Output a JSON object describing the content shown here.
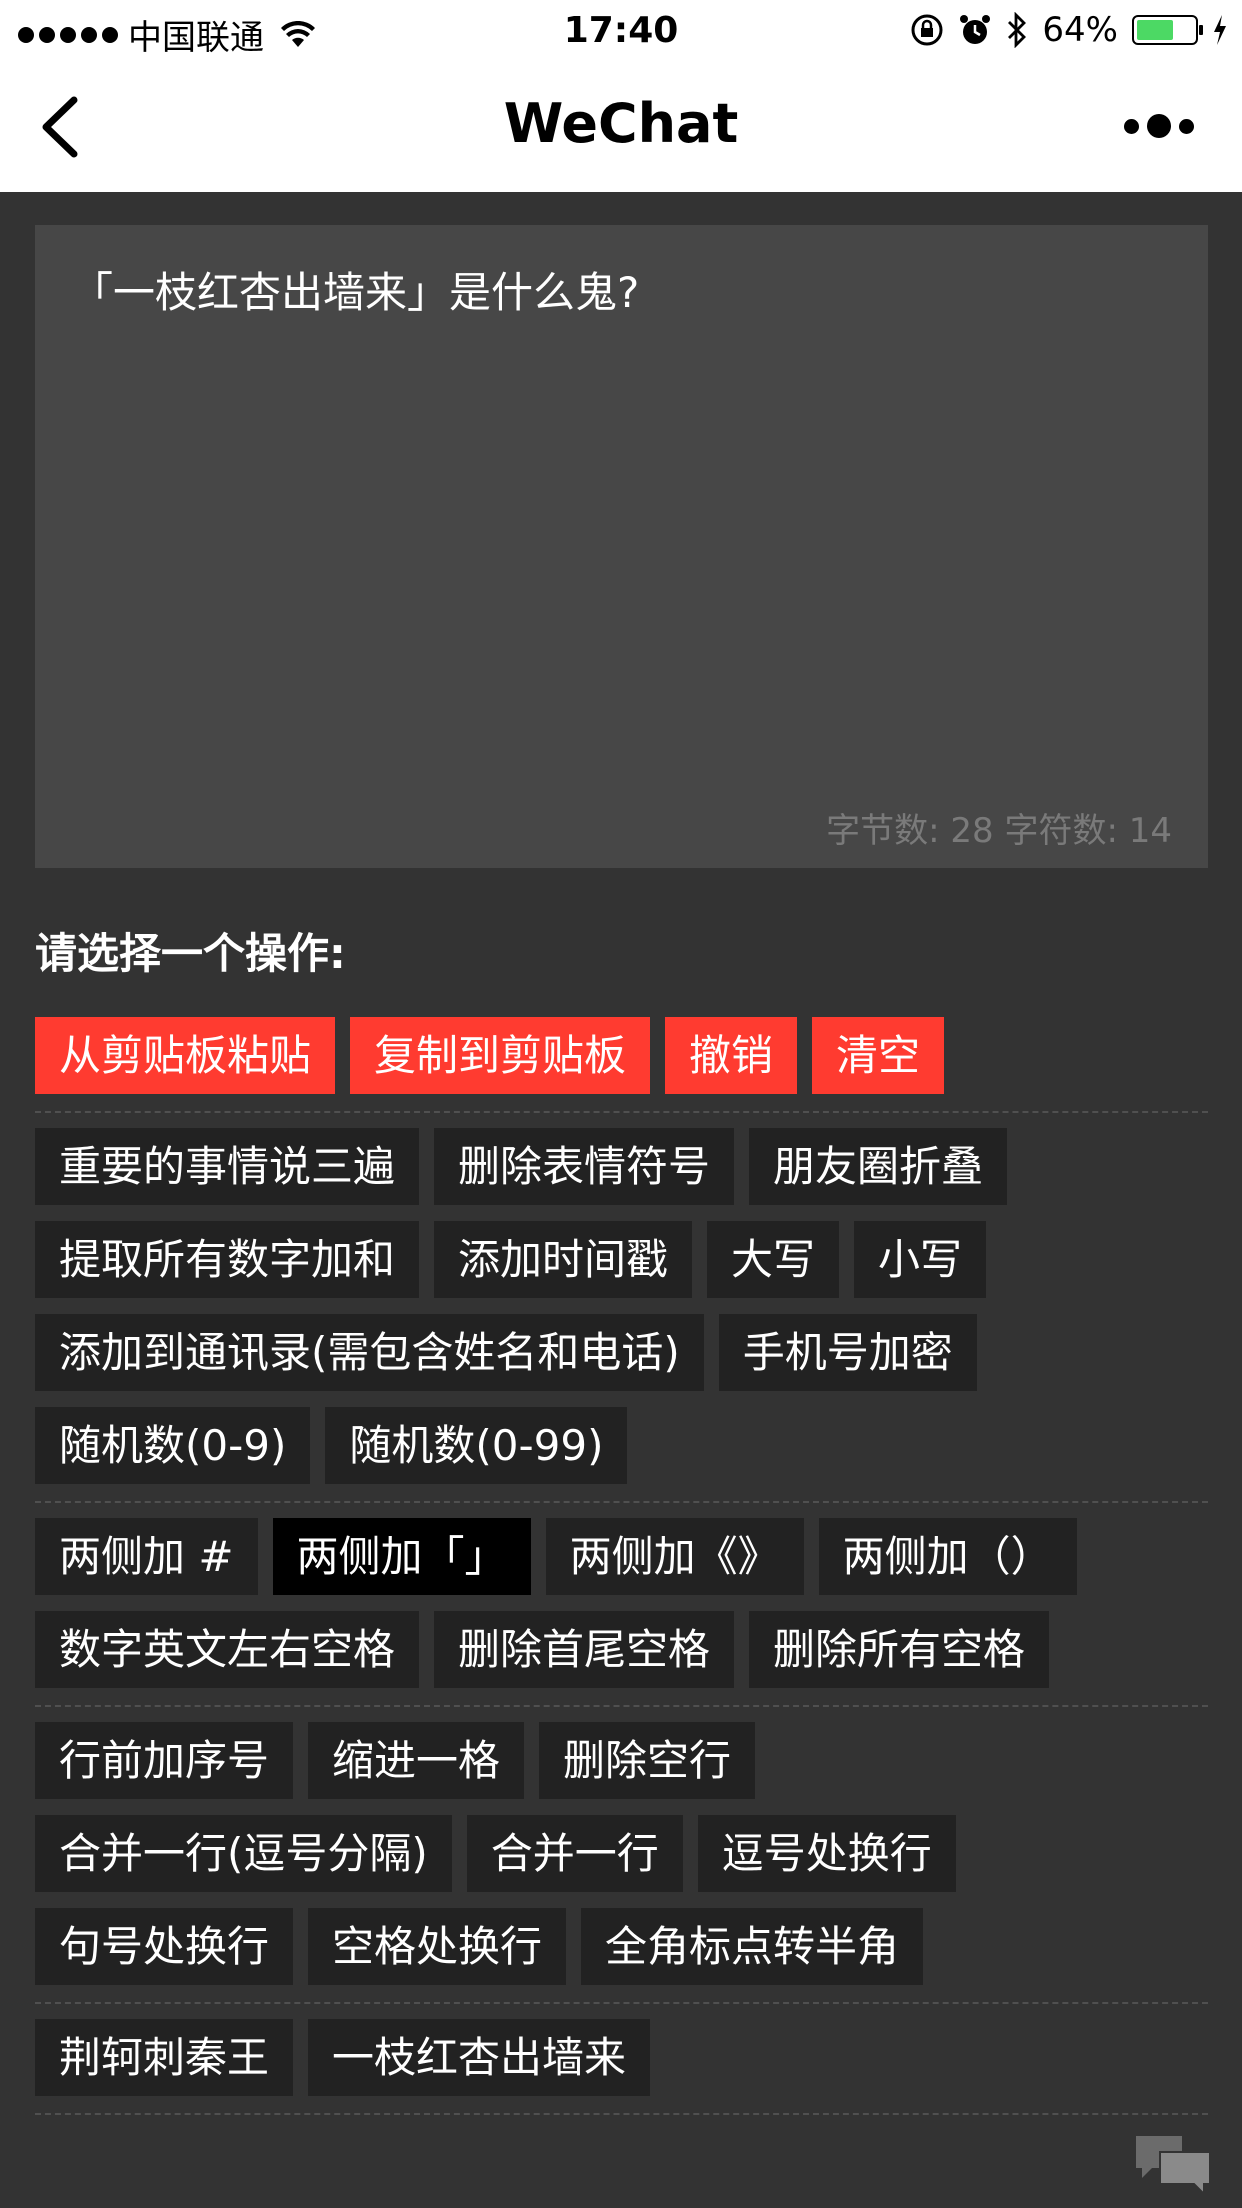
{
  "status_bar": {
    "carrier": "中国联通",
    "time": "17:40",
    "battery": "64%",
    "battery_level": 0.64,
    "icons": [
      "signal-dots-icon",
      "wifi-icon",
      "orientation-lock-icon",
      "alarm-icon",
      "bluetooth-icon",
      "battery-icon",
      "charging-icon"
    ]
  },
  "nav": {
    "title": "WeChat",
    "back_icon": "chevron-left-icon",
    "more_icon": "more-dots-icon"
  },
  "editor": {
    "text": "「一枝红杏出墙来」是什么鬼?",
    "counter": "字节数: 28 字符数: 14"
  },
  "prompt": "请选择一个操作:",
  "groups": {
    "clipboard": [
      "从剪贴板粘贴",
      "复制到剪贴板",
      "撤销",
      "清空"
    ],
    "tools_1": [
      "重要的事情说三遍",
      "删除表情符号",
      "朋友圈折叠"
    ],
    "tools_2": [
      "提取所有数字加和",
      "添加时间戳",
      "大写",
      "小写"
    ],
    "tools_3": [
      "添加到通讯录(需包含姓名和电话)",
      "手机号加密"
    ],
    "tools_4": [
      "随机数(0-9)",
      "随机数(0-99)"
    ],
    "wrap_1": [
      "两侧加 #",
      "两侧加「」",
      "两侧加《》",
      "两侧加（）"
    ],
    "space_1": [
      "数字英文左右空格",
      "删除首尾空格",
      "删除所有空格"
    ],
    "line_1": [
      "行前加序号",
      "缩进一格",
      "删除空行"
    ],
    "line_2": [
      "合并一行(逗号分隔)",
      "合并一行",
      "逗号处换行"
    ],
    "line_3": [
      "句号处换行",
      "空格处换行",
      "全角标点转半角"
    ],
    "sample_1": [
      "荆轲刺秦王",
      "一枝红杏出墙来"
    ]
  },
  "colors": {
    "background": "#333333",
    "accent_red": "#ff3b30",
    "button": "#222222",
    "button_selected": "#000000",
    "editor_bg": "#474747"
  },
  "chat_icon": "chat-bubbles-icon"
}
